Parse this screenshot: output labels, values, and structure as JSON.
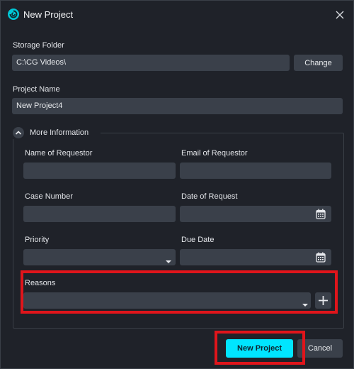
{
  "window": {
    "title": "New Project"
  },
  "storage": {
    "label": "Storage Folder",
    "value": "C:\\CG Videos\\",
    "change_label": "Change"
  },
  "project": {
    "label": "Project Name",
    "value": "New Project4"
  },
  "more_info": {
    "label": "More Information",
    "requestor_name_label": "Name of Requestor",
    "requestor_name_value": "",
    "requestor_email_label": "Email of Requestor",
    "requestor_email_value": "",
    "case_number_label": "Case Number",
    "case_number_value": "",
    "date_of_request_label": "Date of Request",
    "date_of_request_value": "",
    "priority_label": "Priority",
    "priority_value": "",
    "due_date_label": "Due Date",
    "due_date_value": "",
    "reasons_label": "Reasons",
    "reasons_value": ""
  },
  "actions": {
    "new_project_label": "New Project",
    "cancel_label": "Cancel"
  },
  "colors": {
    "accent": "#00e5ff",
    "highlight": "#e0151b",
    "background": "#1f2229",
    "field": "#3a404a"
  }
}
